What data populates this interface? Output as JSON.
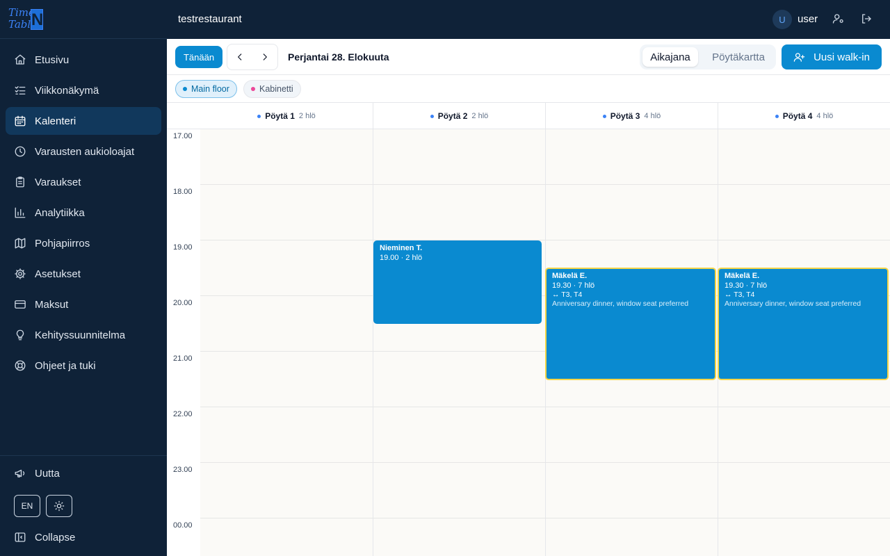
{
  "brand": {
    "logo_line1": "Time",
    "logo_line2": "Table",
    "logo_mark": "N"
  },
  "sidebar": {
    "items": [
      {
        "label": "Etusivu",
        "icon": "home-icon"
      },
      {
        "label": "Viikkonäkymä",
        "icon": "list-check-icon"
      },
      {
        "label": "Kalenteri",
        "icon": "calendar-icon",
        "active": true
      },
      {
        "label": "Varausten aukioloajat",
        "icon": "clock-icon"
      },
      {
        "label": "Varaukset",
        "icon": "clipboard-icon"
      },
      {
        "label": "Analytiikka",
        "icon": "bar-chart-icon"
      },
      {
        "label": "Pohjapiirros",
        "icon": "map-icon"
      },
      {
        "label": "Asetukset",
        "icon": "gear-icon"
      },
      {
        "label": "Maksut",
        "icon": "credit-card-icon"
      },
      {
        "label": "Kehityssuunnitelma",
        "icon": "lightbulb-icon"
      },
      {
        "label": "Ohjeet ja tuki",
        "icon": "lifebuoy-icon"
      }
    ],
    "news_label": "Uutta",
    "language_label": "EN",
    "collapse_label": "Collapse"
  },
  "header": {
    "restaurant": "testrestaurant",
    "avatar_initial": "U",
    "username": "user"
  },
  "toolbar": {
    "today_label": "Tänään",
    "date_label": "Perjantai 28. Elokuuta",
    "view_timeline": "Aikajana",
    "view_tablemap": "Pöytäkartta",
    "walkin_label": "Uusi walk-in"
  },
  "filters": [
    {
      "label": "Main floor",
      "selected": true,
      "color": "#0a8ad0"
    },
    {
      "label": "Kabinetti",
      "selected": false,
      "color": "#ec4899"
    }
  ],
  "tables": [
    {
      "name": "Pöytä 1",
      "capacity": "2 hlö"
    },
    {
      "name": "Pöytä 2",
      "capacity": "2 hlö"
    },
    {
      "name": "Pöytä 3",
      "capacity": "4 hlö"
    },
    {
      "name": "Pöytä 4",
      "capacity": "4 hlö"
    }
  ],
  "hours": [
    "17.00",
    "18.00",
    "19.00",
    "20.00",
    "21.00",
    "22.00",
    "23.00",
    "00.00"
  ],
  "reservations": [
    {
      "name": "Nieminen T.",
      "time": "19.00 · 2 hlö",
      "tables": "",
      "note": "",
      "joined": false
    },
    {
      "name": "Mäkelä E.",
      "time": "19.30 · 7 hlö",
      "tables": "↔ T3, T4",
      "note": "Anniversary dinner, window seat preferred",
      "joined": true
    },
    {
      "name": "Mäkelä E.",
      "time": "19.30 · 7 hlö",
      "tables": "↔ T3, T4",
      "note": "Anniversary dinner, window seat preferred",
      "joined": true
    }
  ],
  "colors": {
    "sidebar_bg": "#0f2238",
    "accent": "#0a8ad0",
    "joined_border": "#f5d547"
  }
}
